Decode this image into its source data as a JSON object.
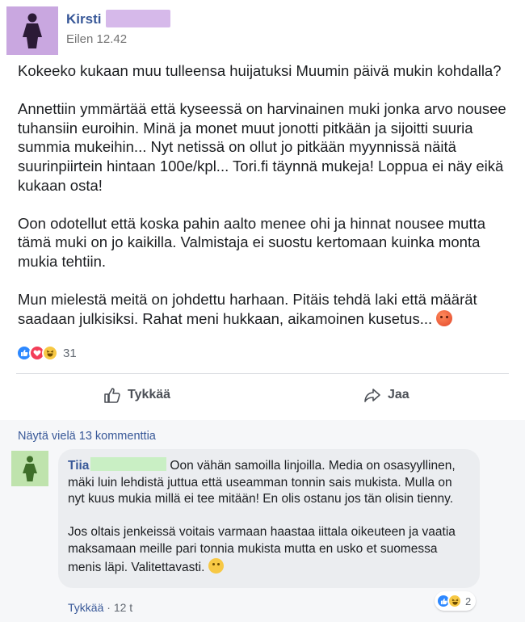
{
  "post": {
    "author": "Kirsti",
    "timestamp": "Eilen 12.42",
    "paragraphs": [
      "Kokeeko kukaan muu tulleensa huijatuksi Muumin päivä mukin kohdalla?",
      "Annettiin ymmärtää että kyseessä on harvinainen muki jonka arvo nousee tuhansiin euroihin. Minä ja monet muut jonotti pitkään ja sijoitti suuria summia mukeihin... Nyt netissä on ollut jo pitkään myynnissä näitä suurinpiirtein hintaan 100e/kpl... Tori.fi täynnä mukeja! Loppua ei näy eikä kukaan osta!",
      "Oon odotellut että koska pahin aalto menee ohi ja hinnat nousee mutta tämä muki on jo kaikilla. Valmistaja ei suostu kertomaan kuinka monta mukia tehtiin.",
      "Mun mielestä meitä on johdettu harhaan. Pitäis tehdä laki että määrät saadaan julkisiksi. Rahat meni hukkaan, aikamoinen kusetus..."
    ],
    "end_emoji": "angry-face-icon",
    "reactions": {
      "types": [
        "like",
        "love",
        "haha"
      ],
      "count": "31"
    }
  },
  "actions": {
    "like_label": "Tykkää",
    "share_label": "Jaa"
  },
  "comments": {
    "more_label": "Näytä vielä 13 kommenttia",
    "items": [
      {
        "author": "Tiia",
        "first_paragraph": "Oon vähän samoilla linjoilla. Media on osasyyllinen, mäki luin lehdistä juttua että useamman tonnin sais mukista. Mulla on nyt kuus mukia millä ei tee mitään! En olis ostanu jos tän olisin tienny.",
        "second_paragraph": "Jos oltais jenkeissä voitais varmaan haastaa iittala oikeuteen ja vaatia maksamaan meille pari tonnia mukista mutta en usko et suomessa menis läpi. Valitettavasti.",
        "end_emoji": "sad-face-icon",
        "like_label": "Tykkää",
        "separator": " · ",
        "age": "12 t",
        "reactions": {
          "types": [
            "like",
            "haha"
          ],
          "count": "2"
        }
      }
    ]
  },
  "colors": {
    "link_blue": "#385898",
    "post_avatar_bg": "#c9a7e0",
    "comment_avatar_bg": "#bfe3ad",
    "like_blue": "#2d88ff",
    "love_red": "#f33e58",
    "haha_yellow": "#f7c844"
  }
}
